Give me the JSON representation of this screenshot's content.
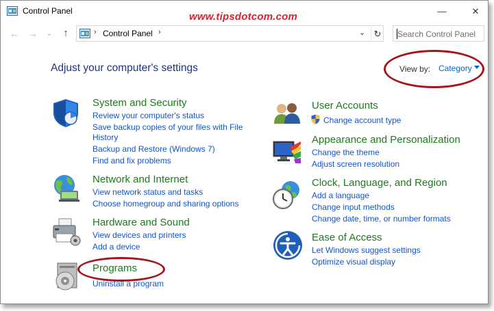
{
  "window": {
    "title": "Control Panel",
    "watermark": "www.tipsdotcom.com",
    "minimize_glyph": "—",
    "close_glyph": "✕"
  },
  "nav": {
    "back_glyph": "←",
    "forward_glyph": "→",
    "recent_glyph": "⌄",
    "up_glyph": "↑",
    "address_sep1": "›",
    "address_text": "Control Panel",
    "address_sep2": "›",
    "dropdown_glyph": "⌄",
    "refresh_glyph": "↻",
    "search_placeholder": "Search Control Panel"
  },
  "header": {
    "heading": "Adjust your computer's settings",
    "view_by_label": "View by:",
    "view_by_value": "Category"
  },
  "categories": [
    {
      "icon": "shield-icon",
      "title": "System and Security",
      "links": [
        "Review your computer's status",
        "Save backup copies of your files with File",
        "History",
        "Backup and Restore (Windows 7)",
        "Find and fix problems"
      ]
    },
    {
      "icon": "globe-network-icon",
      "title": "Network and Internet",
      "links": [
        "View network status and tasks",
        "Choose homegroup and sharing options"
      ]
    },
    {
      "icon": "printer-icon",
      "title": "Hardware and Sound",
      "links": [
        "View devices and printers",
        "Add a device"
      ]
    },
    {
      "icon": "programs-disc-icon",
      "title": "Programs",
      "links": [
        "Uninstall a program"
      ]
    },
    {
      "icon": "users-icon",
      "title": "User Accounts",
      "links": [
        "Change account type"
      ]
    },
    {
      "icon": "monitor-paint-icon",
      "title": "Appearance and Personalization",
      "links": [
        "Change the theme",
        "Adjust screen resolution"
      ]
    },
    {
      "icon": "clock-globe-icon",
      "title": "Clock, Language, and Region",
      "links": [
        "Add a language",
        "Change input methods",
        "Change date, time, or number formats"
      ]
    },
    {
      "icon": "ease-of-access-icon",
      "title": "Ease of Access",
      "links": [
        "Let Windows suggest settings",
        "Optimize visual display"
      ]
    }
  ],
  "colors": {
    "heading": "#1e3287",
    "category_title": "#1c7b1c",
    "link": "#1155cc",
    "annotation": "#a8141c",
    "watermark": "#e0202a"
  }
}
